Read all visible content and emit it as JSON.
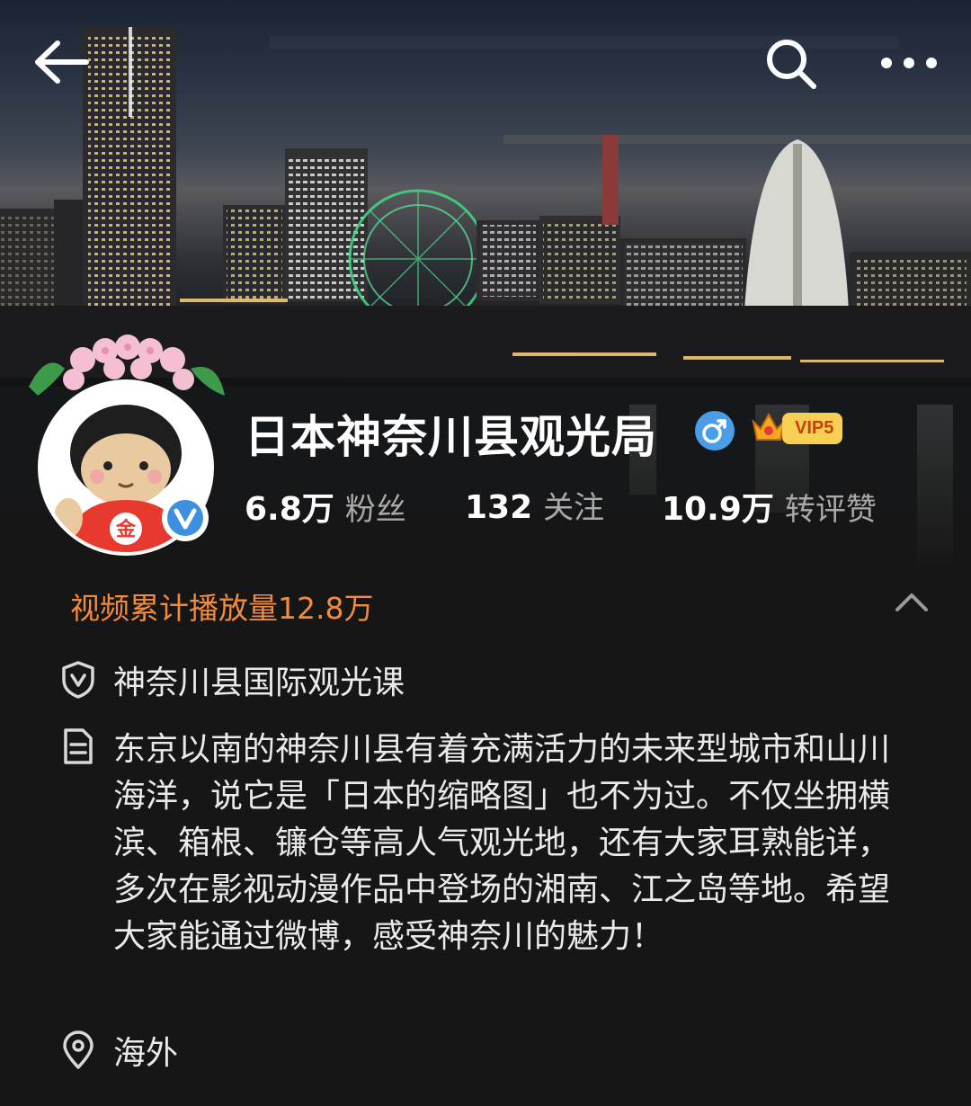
{
  "nav": {
    "back": "back-arrow",
    "search": "search-icon",
    "more": "more-icon"
  },
  "profile": {
    "name": "日本神奈川县观光局",
    "gender": "male",
    "vip_label": "VIP5",
    "avatar_badge": "金"
  },
  "stats": [
    {
      "num": "6.8万",
      "label": "粉丝"
    },
    {
      "num": "132",
      "label": "关注"
    },
    {
      "num": "10.9万",
      "label": "转评赞"
    }
  ],
  "video_count": "视频累计播放量12.8万",
  "info": {
    "certification": "神奈川县国际观光课",
    "description": "东京以南的神奈川县有着充满活力的未来型城市和山川海洋，说它是「日本的缩略图」也不为过。不仅坐拥横滨、箱根、镰仓等高人气观光地，还有大家耳熟能详，多次在影视动漫作品中登场的湘南、江之岛等地。希望大家能通过微博，感受神奈川的魅力！",
    "location": "海外"
  },
  "colors": {
    "accent_orange": "#f28b3c",
    "verified_blue": "#3f8fe0",
    "vip_gold": "#f6cf53"
  }
}
